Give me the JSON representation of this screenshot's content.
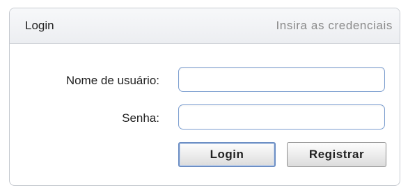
{
  "header": {
    "title": "Login",
    "subtitle": "Insira as credenciais"
  },
  "form": {
    "username_label": "Nome de usuário:",
    "username_value": "",
    "password_label": "Senha:",
    "password_value": ""
  },
  "buttons": {
    "login_label": "Login",
    "register_label": "Registrar"
  },
  "colors": {
    "input_border": "#7d9fd0",
    "default_button_border": "#6d8fc4",
    "header_background": "#eceef1"
  }
}
